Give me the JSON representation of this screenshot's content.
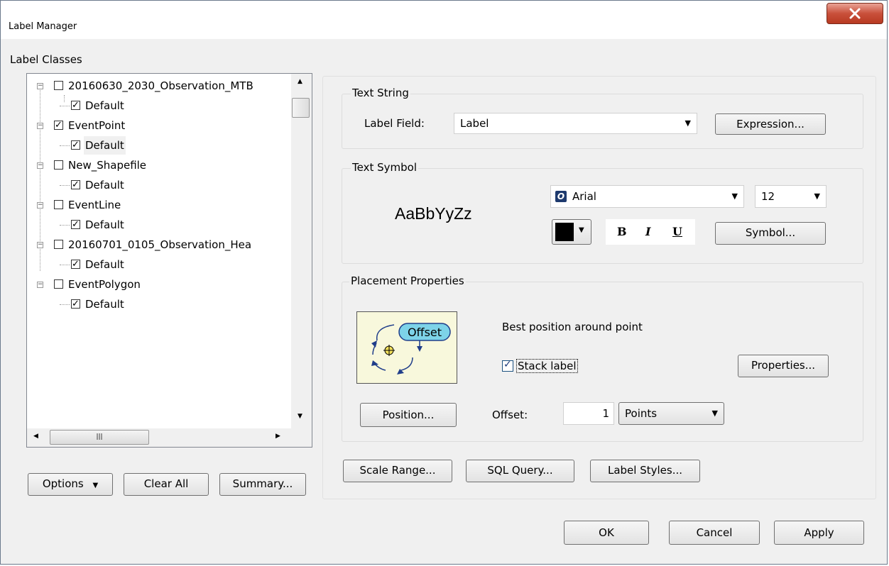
{
  "window": {
    "title": "Label Manager"
  },
  "label_classes": {
    "heading": "Label Classes",
    "items": [
      {
        "label": "20160630_2030_Observation_MTB",
        "checked": false,
        "child": {
          "label": "Default",
          "checked": true
        }
      },
      {
        "label": "EventPoint",
        "checked": true,
        "child": {
          "label": "Default",
          "checked": true,
          "selected": true
        }
      },
      {
        "label": "New_Shapefile",
        "checked": false,
        "child": {
          "label": "Default",
          "checked": true
        }
      },
      {
        "label": "EventLine",
        "checked": false,
        "child": {
          "label": "Default",
          "checked": true
        }
      },
      {
        "label": "20160701_0105_Observation_Hea",
        "checked": false,
        "child": {
          "label": "Default",
          "checked": true
        }
      },
      {
        "label": "EventPolygon",
        "checked": false,
        "child": {
          "label": "Default",
          "checked": true
        }
      }
    ],
    "options_button": "Options",
    "clear_all_button": "Clear All",
    "summary_button": "Summary..."
  },
  "text_string": {
    "title": "Text String",
    "label_field_label": "Label Field:",
    "label_field_value": "Label",
    "expression_button": "Expression..."
  },
  "text_symbol": {
    "title": "Text Symbol",
    "preview_text": "AaBbYyZz",
    "font": "Arial",
    "size": "12",
    "bold": "B",
    "italic": "I",
    "underline": "U",
    "symbol_button": "Symbol...",
    "color": "#000000"
  },
  "placement": {
    "title": "Placement Properties",
    "offset_badge": "Offset",
    "description": "Best position around point",
    "stack_label": "Stack label",
    "stack_checked": true,
    "properties_button": "Properties...",
    "position_button": "Position...",
    "offset_label": "Offset:",
    "offset_value": "1",
    "offset_unit": "Points"
  },
  "bottom_buttons": {
    "scale_range": "Scale Range...",
    "sql_query": "SQL Query...",
    "label_styles": "Label Styles..."
  },
  "dialog_buttons": {
    "ok": "OK",
    "cancel": "Cancel",
    "apply": "Apply"
  }
}
